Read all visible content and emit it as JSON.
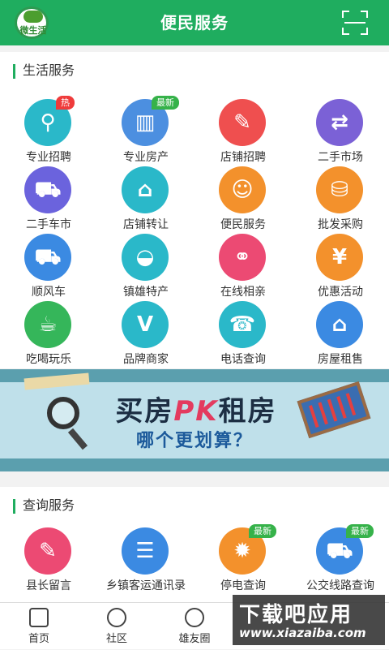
{
  "header": {
    "title": "便民服务",
    "logo_text": "微生活",
    "scan_icon": "scan-icon"
  },
  "life_services": {
    "heading": "生活服务",
    "items": [
      {
        "label": "专业招聘",
        "color": "#2ab8c9",
        "icon": "recruit-icon",
        "badge": "热"
      },
      {
        "label": "专业房产",
        "color": "#4c8fe0",
        "icon": "building-icon",
        "badge": "最新"
      },
      {
        "label": "店铺招聘",
        "color": "#ef4f4f",
        "icon": "person-pen-icon"
      },
      {
        "label": "二手市场",
        "color": "#7b61d6",
        "icon": "exchange-icon"
      },
      {
        "label": "二手车市",
        "color": "#6b63dd",
        "icon": "car-icon"
      },
      {
        "label": "店铺转让",
        "color": "#2ab8c9",
        "icon": "shop-icon"
      },
      {
        "label": "便民服务",
        "color": "#f3912c",
        "icon": "service-person-icon"
      },
      {
        "label": "批发采购",
        "color": "#f3912c",
        "icon": "cart-icon"
      },
      {
        "label": "顺风车",
        "color": "#3b8ae2",
        "icon": "carpool-icon"
      },
      {
        "label": "镇雄特产",
        "color": "#2ab8c9",
        "icon": "basket-icon"
      },
      {
        "label": "在线相亲",
        "color": "#ec4a73",
        "icon": "couple-icon"
      },
      {
        "label": "优惠活动",
        "color": "#f3912c",
        "icon": "coupon-icon"
      },
      {
        "label": "吃喝玩乐",
        "color": "#35b65a",
        "icon": "coffee-icon"
      },
      {
        "label": "品牌商家",
        "color": "#2ab8c9",
        "icon": "brand-v-icon"
      },
      {
        "label": "电话查询",
        "color": "#2ab8c9",
        "icon": "phone-icon"
      },
      {
        "label": "房屋租售",
        "color": "#3b8ae2",
        "icon": "house-icon"
      }
    ]
  },
  "banner": {
    "line1_a": "买房",
    "line1_pk": "PK",
    "line1_b": "租房",
    "line2": "哪个更划算？"
  },
  "query_services": {
    "heading": "查询服务",
    "items": [
      {
        "label": "县长留言",
        "color": "#ec4a73",
        "icon": "message-edit-icon"
      },
      {
        "label": "乡镇客运通讯录",
        "color": "#3b8ae2",
        "icon": "contact-book-icon"
      },
      {
        "label": "停电查询",
        "color": "#f3912c",
        "icon": "bulb-icon",
        "badge": "最新"
      },
      {
        "label": "公交线路查询",
        "color": "#3b8ae2",
        "icon": "bus-icon",
        "badge": "最新"
      }
    ]
  },
  "tabbar": {
    "items": [
      {
        "label": "首页",
        "icon": "home-icon"
      },
      {
        "label": "社区",
        "icon": "community-icon"
      },
      {
        "label": "雄友圈",
        "icon": "circle-icon"
      }
    ]
  },
  "watermark": {
    "line1": "下载吧应用",
    "line2": "www.xiazaiba.com"
  }
}
